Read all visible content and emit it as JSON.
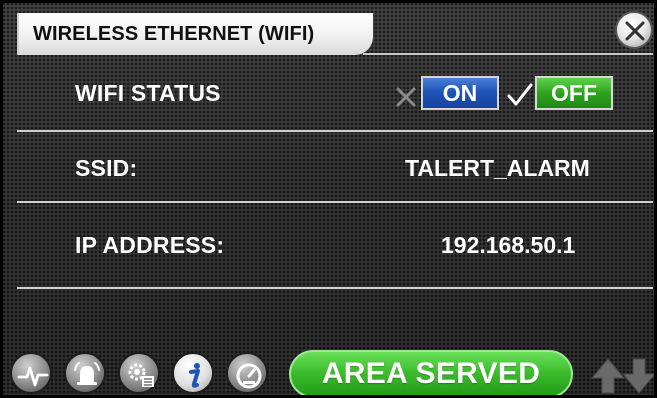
{
  "header": {
    "title": "WIRELESS ETHERNET (WIFI)",
    "close_icon": "close-icon"
  },
  "wifi_status": {
    "label": "WIFI STATUS",
    "on_label": "ON",
    "off_label": "OFF",
    "selected": "OFF",
    "on_color": "#1f54b8",
    "off_color": "#2ea31e"
  },
  "ssid": {
    "label": "SSID:",
    "value": "TALERT_ALARM"
  },
  "ip": {
    "label": "IP ADDRESS:",
    "value": "192.168.50.1"
  },
  "nav": {
    "icons": [
      "pulse-icon",
      "alarm-bell-icon",
      "settings-list-icon",
      "info-icon",
      "gauge-icon"
    ],
    "active_icon": "info-icon",
    "area_button": "AREA SERVED",
    "arrows": [
      "up-arrow-icon",
      "down-arrow-icon"
    ]
  },
  "colors": {
    "accent_green": "#3dbd2d",
    "accent_blue": "#1f54b8",
    "background": "#2f2f2f"
  }
}
